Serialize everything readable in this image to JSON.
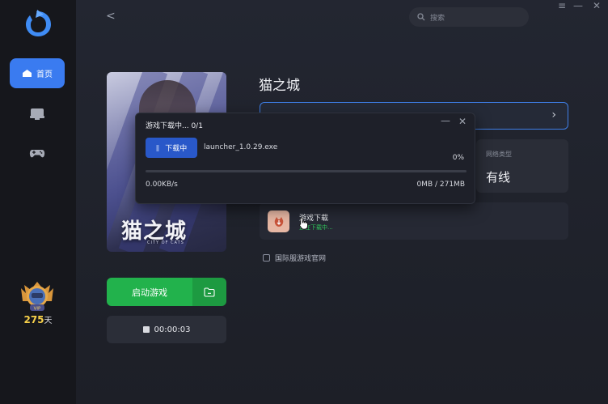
{
  "sidebar": {
    "home_label": "首页",
    "vip_badge": "VIP",
    "days_value": "275",
    "days_unit": "天"
  },
  "header": {
    "back_glyph": "<",
    "search_placeholder": "搜索",
    "menu_glyph": "≡",
    "minimize_glyph": "—",
    "close_glyph": "✕"
  },
  "game": {
    "title": "猫之城",
    "cover_title": "猫之城",
    "cover_subtitle": "CITY OF CATS",
    "launch_label": "启动游戏",
    "timer": "00:00:03"
  },
  "network": {
    "label": "网络类型",
    "value": "有线"
  },
  "download_card": {
    "title": "游戏下载",
    "status": "正在下载中..."
  },
  "site_link": "国际服游戏官网",
  "popup": {
    "title": "游戏下载中... 0/1",
    "button_label": "下载中",
    "pause_glyph": "||",
    "filename": "launcher_1.0.29.exe",
    "percent": "0%",
    "progress": 0,
    "speed": "0.00KB/s",
    "size": "0MB / 271MB"
  },
  "colors": {
    "accent": "#3a7bf0",
    "launch_green": "#22b24c",
    "status_green": "#2fc45a",
    "vip_gold": "#f5cf4a"
  }
}
